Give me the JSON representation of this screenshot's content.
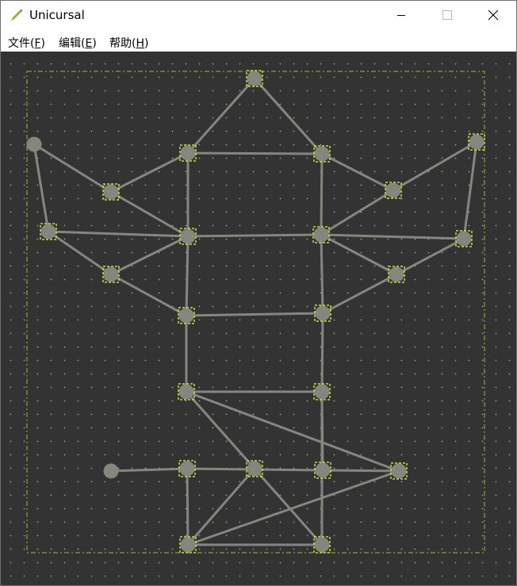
{
  "window": {
    "title": "Unicursal",
    "icon": "pencil-icon",
    "controls": {
      "minimize": "minimize-icon",
      "maximize": "maximize-icon",
      "close": "close-icon"
    }
  },
  "menu": {
    "items": [
      {
        "pre": "文件(",
        "key": "F",
        "post": ")"
      },
      {
        "pre": "编辑(",
        "key": "E",
        "post": ")"
      },
      {
        "pre": "帮助(",
        "key": "H",
        "post": ")"
      }
    ]
  },
  "colors": {
    "canvas_bg": "#333333",
    "grid_dot": "#a0a0a0",
    "edge": "#85877f",
    "node": "#85877f",
    "selection": "#c8e030",
    "boundary": "#a5b427"
  },
  "graph": {
    "nodes": [
      {
        "id": "n0",
        "selected": true
      },
      {
        "id": "n1",
        "selected": false
      },
      {
        "id": "n2",
        "selected": true
      },
      {
        "id": "n3",
        "selected": true
      },
      {
        "id": "n4",
        "selected": true
      },
      {
        "id": "n5",
        "selected": true
      },
      {
        "id": "n6",
        "selected": true
      },
      {
        "id": "n7",
        "selected": true
      },
      {
        "id": "n8",
        "selected": true
      },
      {
        "id": "n9",
        "selected": true
      },
      {
        "id": "n10",
        "selected": true
      },
      {
        "id": "n11",
        "selected": true
      },
      {
        "id": "n12",
        "selected": true
      },
      {
        "id": "n13",
        "selected": true
      },
      {
        "id": "n14",
        "selected": true
      },
      {
        "id": "n15",
        "selected": true
      },
      {
        "id": "n16",
        "selected": true
      },
      {
        "id": "n17",
        "selected": true
      },
      {
        "id": "n18",
        "selected": false
      },
      {
        "id": "n19",
        "selected": true
      },
      {
        "id": "n20",
        "selected": true
      },
      {
        "id": "n21",
        "selected": true
      },
      {
        "id": "n22",
        "selected": true
      },
      {
        "id": "n23",
        "selected": true
      },
      {
        "id": "n24",
        "selected": true
      }
    ],
    "edges": [
      [
        "n0",
        "n3"
      ],
      [
        "n0",
        "n4"
      ],
      [
        "n3",
        "n4"
      ],
      [
        "n1",
        "n5"
      ],
      [
        "n1",
        "n7"
      ],
      [
        "n5",
        "n3"
      ],
      [
        "n5",
        "n8"
      ],
      [
        "n7",
        "n8"
      ],
      [
        "n7",
        "n11"
      ],
      [
        "n11",
        "n8"
      ],
      [
        "n3",
        "n8"
      ],
      [
        "n8",
        "n9"
      ],
      [
        "n2",
        "n6"
      ],
      [
        "n2",
        "n10"
      ],
      [
        "n6",
        "n4"
      ],
      [
        "n6",
        "n9"
      ],
      [
        "n10",
        "n9"
      ],
      [
        "n10",
        "n12"
      ],
      [
        "n12",
        "n9"
      ],
      [
        "n4",
        "n9"
      ],
      [
        "n8",
        "n13"
      ],
      [
        "n11",
        "n13"
      ],
      [
        "n9",
        "n14"
      ],
      [
        "n12",
        "n14"
      ],
      [
        "n13",
        "n14"
      ],
      [
        "n13",
        "n15"
      ],
      [
        "n14",
        "n16"
      ],
      [
        "n15",
        "n16"
      ],
      [
        "n15",
        "n17"
      ],
      [
        "n15",
        "n21"
      ],
      [
        "n16",
        "n20"
      ],
      [
        "n16",
        "n24"
      ],
      [
        "n18",
        "n19"
      ],
      [
        "n19",
        "n20"
      ],
      [
        "n20",
        "n21"
      ],
      [
        "n19",
        "n23"
      ],
      [
        "n21",
        "n22"
      ],
      [
        "n17",
        "n23"
      ],
      [
        "n17",
        "n24"
      ],
      [
        "n23",
        "n24"
      ]
    ]
  }
}
